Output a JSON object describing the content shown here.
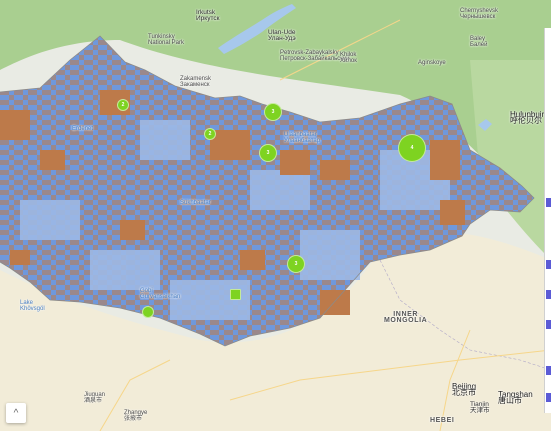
{
  "colors": {
    "land": "#e9ebe4",
    "forest": "#a9cf90",
    "desert": "#f2ecd8",
    "water": "#a7c8ec",
    "mongolia_blue": "#6f98dc",
    "mongolia_light": "#9db9e6",
    "license_brown": "#bd7a4a",
    "marker_green": "#7ed321",
    "side_accent": "#5b5bd6"
  },
  "labels": {
    "irkutsk": "Irkutsk\nИркутск",
    "tunkinsky": "Tunkinsky\nNational Park",
    "ulan_ude": "Ulan-Ude\nУлан-Удэ",
    "zakamensk": "Zakamensk\nЗакаменск",
    "petrovsk": "Petrovsk-Zabaykalsky\nПетровск-Забайкальский",
    "khilok": "Khilok\nХилок",
    "chernyshevsk": "Chernyshevsk\nЧернышевск",
    "baley": "Baley\nБалей",
    "aginskoye": "Aginskoye",
    "hulunbuir": "Hulunbuir\n呼伦贝尔",
    "inner_mongolia": "INNER\nMONGOLIA",
    "beijing": "Beijing\n北京市",
    "tangshan": "Tangshan\n唐山市",
    "tianjin": "Tianjin\n天津市",
    "hebei": "HEBEI",
    "jiuquan": "Jiuquan\n酒泉市",
    "zhangye": "Zhangye\n张掖市",
    "zhangjiakou": "Zhangjiakou",
    "sukhbaatar": "Sükhbaatar",
    "erdenet": "Erdenet",
    "ulaanbaatar": "Ulaanbaatar\nУлаанбаатар",
    "gobi": "Gobi\nGurvansaikhan",
    "lake": "Lake\nKhövsgöl"
  },
  "clusters": [
    {
      "count": "2"
    },
    {
      "count": "2"
    },
    {
      "count": "3"
    },
    {
      "count": "3"
    },
    {
      "count": "4"
    },
    {
      "count": "3"
    },
    {
      "count": ""
    },
    {
      "count": ""
    }
  ],
  "controls": {
    "collapse_icon": "chevron-up-icon",
    "collapse_glyph": "^"
  }
}
